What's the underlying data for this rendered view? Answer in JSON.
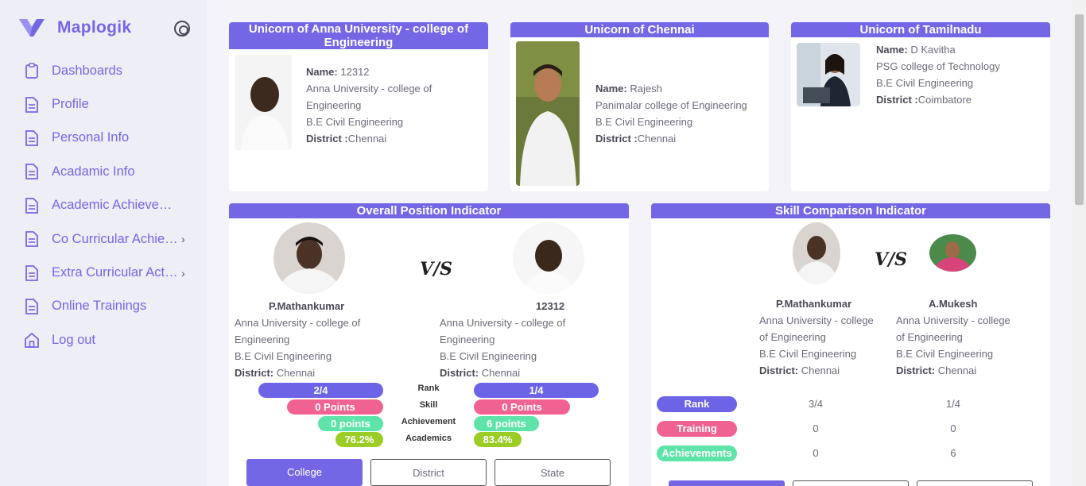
{
  "app": {
    "name": "Maplogik"
  },
  "sidebar": {
    "items": [
      {
        "label": "Dashboards",
        "icon": "clipboard-icon"
      },
      {
        "label": "Profile",
        "icon": "document-icon"
      },
      {
        "label": "Personal Info",
        "icon": "document-icon"
      },
      {
        "label": "Acadamic Info",
        "icon": "document-icon"
      },
      {
        "label": "Academic Achievements",
        "icon": "document-icon"
      },
      {
        "label": "Co Curricular Achievements",
        "icon": "document-icon",
        "has_children": true
      },
      {
        "label": "Extra Curricular Activities",
        "icon": "document-icon",
        "has_children": true
      },
      {
        "label": "Online Trainings",
        "icon": "document-icon"
      },
      {
        "label": "Log out",
        "icon": "home-icon"
      }
    ]
  },
  "unicorns": [
    {
      "title": "Unicorn of Anna University - college of Engineering",
      "name_label": "Name:",
      "name": "12312",
      "college": "Anna University - college of Engineering",
      "degree": "B.E Civil Engineering",
      "district_label": "District :",
      "district": "Chennai"
    },
    {
      "title": "Unicorn of Chennai",
      "name_label": "Name:",
      "name": "Rajesh",
      "college": "Panimalar college of Engineering",
      "degree": "B.E Civil Engineering",
      "district_label": "District :",
      "district": "Chennai"
    },
    {
      "title": "Unicorn of Tamilnadu",
      "name_label": "Name:",
      "name": "D Kavitha",
      "college": "PSG college of Technology",
      "degree": "B.E Civil Engineering",
      "district_label": "District :",
      "district": "Coimbatore"
    }
  ],
  "overall": {
    "title": "Overall Position Indicator",
    "vs": "V/S",
    "left": {
      "name": "P.Mathankumar",
      "college": "Anna University - college of Engineering",
      "degree": "B.E Civil Engineering",
      "district_label": "District:",
      "district": "Chennai"
    },
    "right": {
      "name": "12312",
      "college": "Anna University - college of Engineering",
      "degree": "B.E Civil Engineering",
      "district_label": "District:",
      "district": "Chennai"
    },
    "metrics": [
      {
        "label": "Rank",
        "left": "2/4",
        "right": "1/4",
        "color": "#6c63e6"
      },
      {
        "label": "Skill",
        "left": "0 Points",
        "right": "0 Points",
        "color": "#f06292"
      },
      {
        "label": "Achievement",
        "left": "0 points",
        "right": "6 points",
        "color": "#5ee4a8"
      },
      {
        "label": "Academics",
        "left": "76.2%",
        "right": "83.4%",
        "color": "#9ccc26"
      }
    ],
    "tabs": [
      "College",
      "District",
      "State"
    ],
    "active_tab": "College"
  },
  "skill": {
    "title": "Skill Comparison Indicator",
    "vs": "V/S",
    "left": {
      "name": "P.Mathankumar",
      "college": "Anna University - college of Engineering",
      "degree": "B.E Civil Engineering",
      "district_label": "District:",
      "district": "Chennai"
    },
    "right": {
      "name": "A.Mukesh",
      "college": "Anna University - college of Engineering",
      "degree": "B.E Civil Engineering",
      "district_label": "District:",
      "district": "Chennai"
    },
    "rows": [
      {
        "label": "Rank",
        "left": "3/4",
        "right": "1/4",
        "color": "#6c63e6"
      },
      {
        "label": "Training",
        "left": "0",
        "right": "0",
        "color": "#f06292"
      },
      {
        "label": "Achievements",
        "left": "0",
        "right": "6",
        "color": "#5ee4a8"
      }
    ]
  },
  "colors": {
    "accent": "#7367e6",
    "sidebar_bg": "#eeeef6",
    "page_bg": "#f3f3f9"
  }
}
